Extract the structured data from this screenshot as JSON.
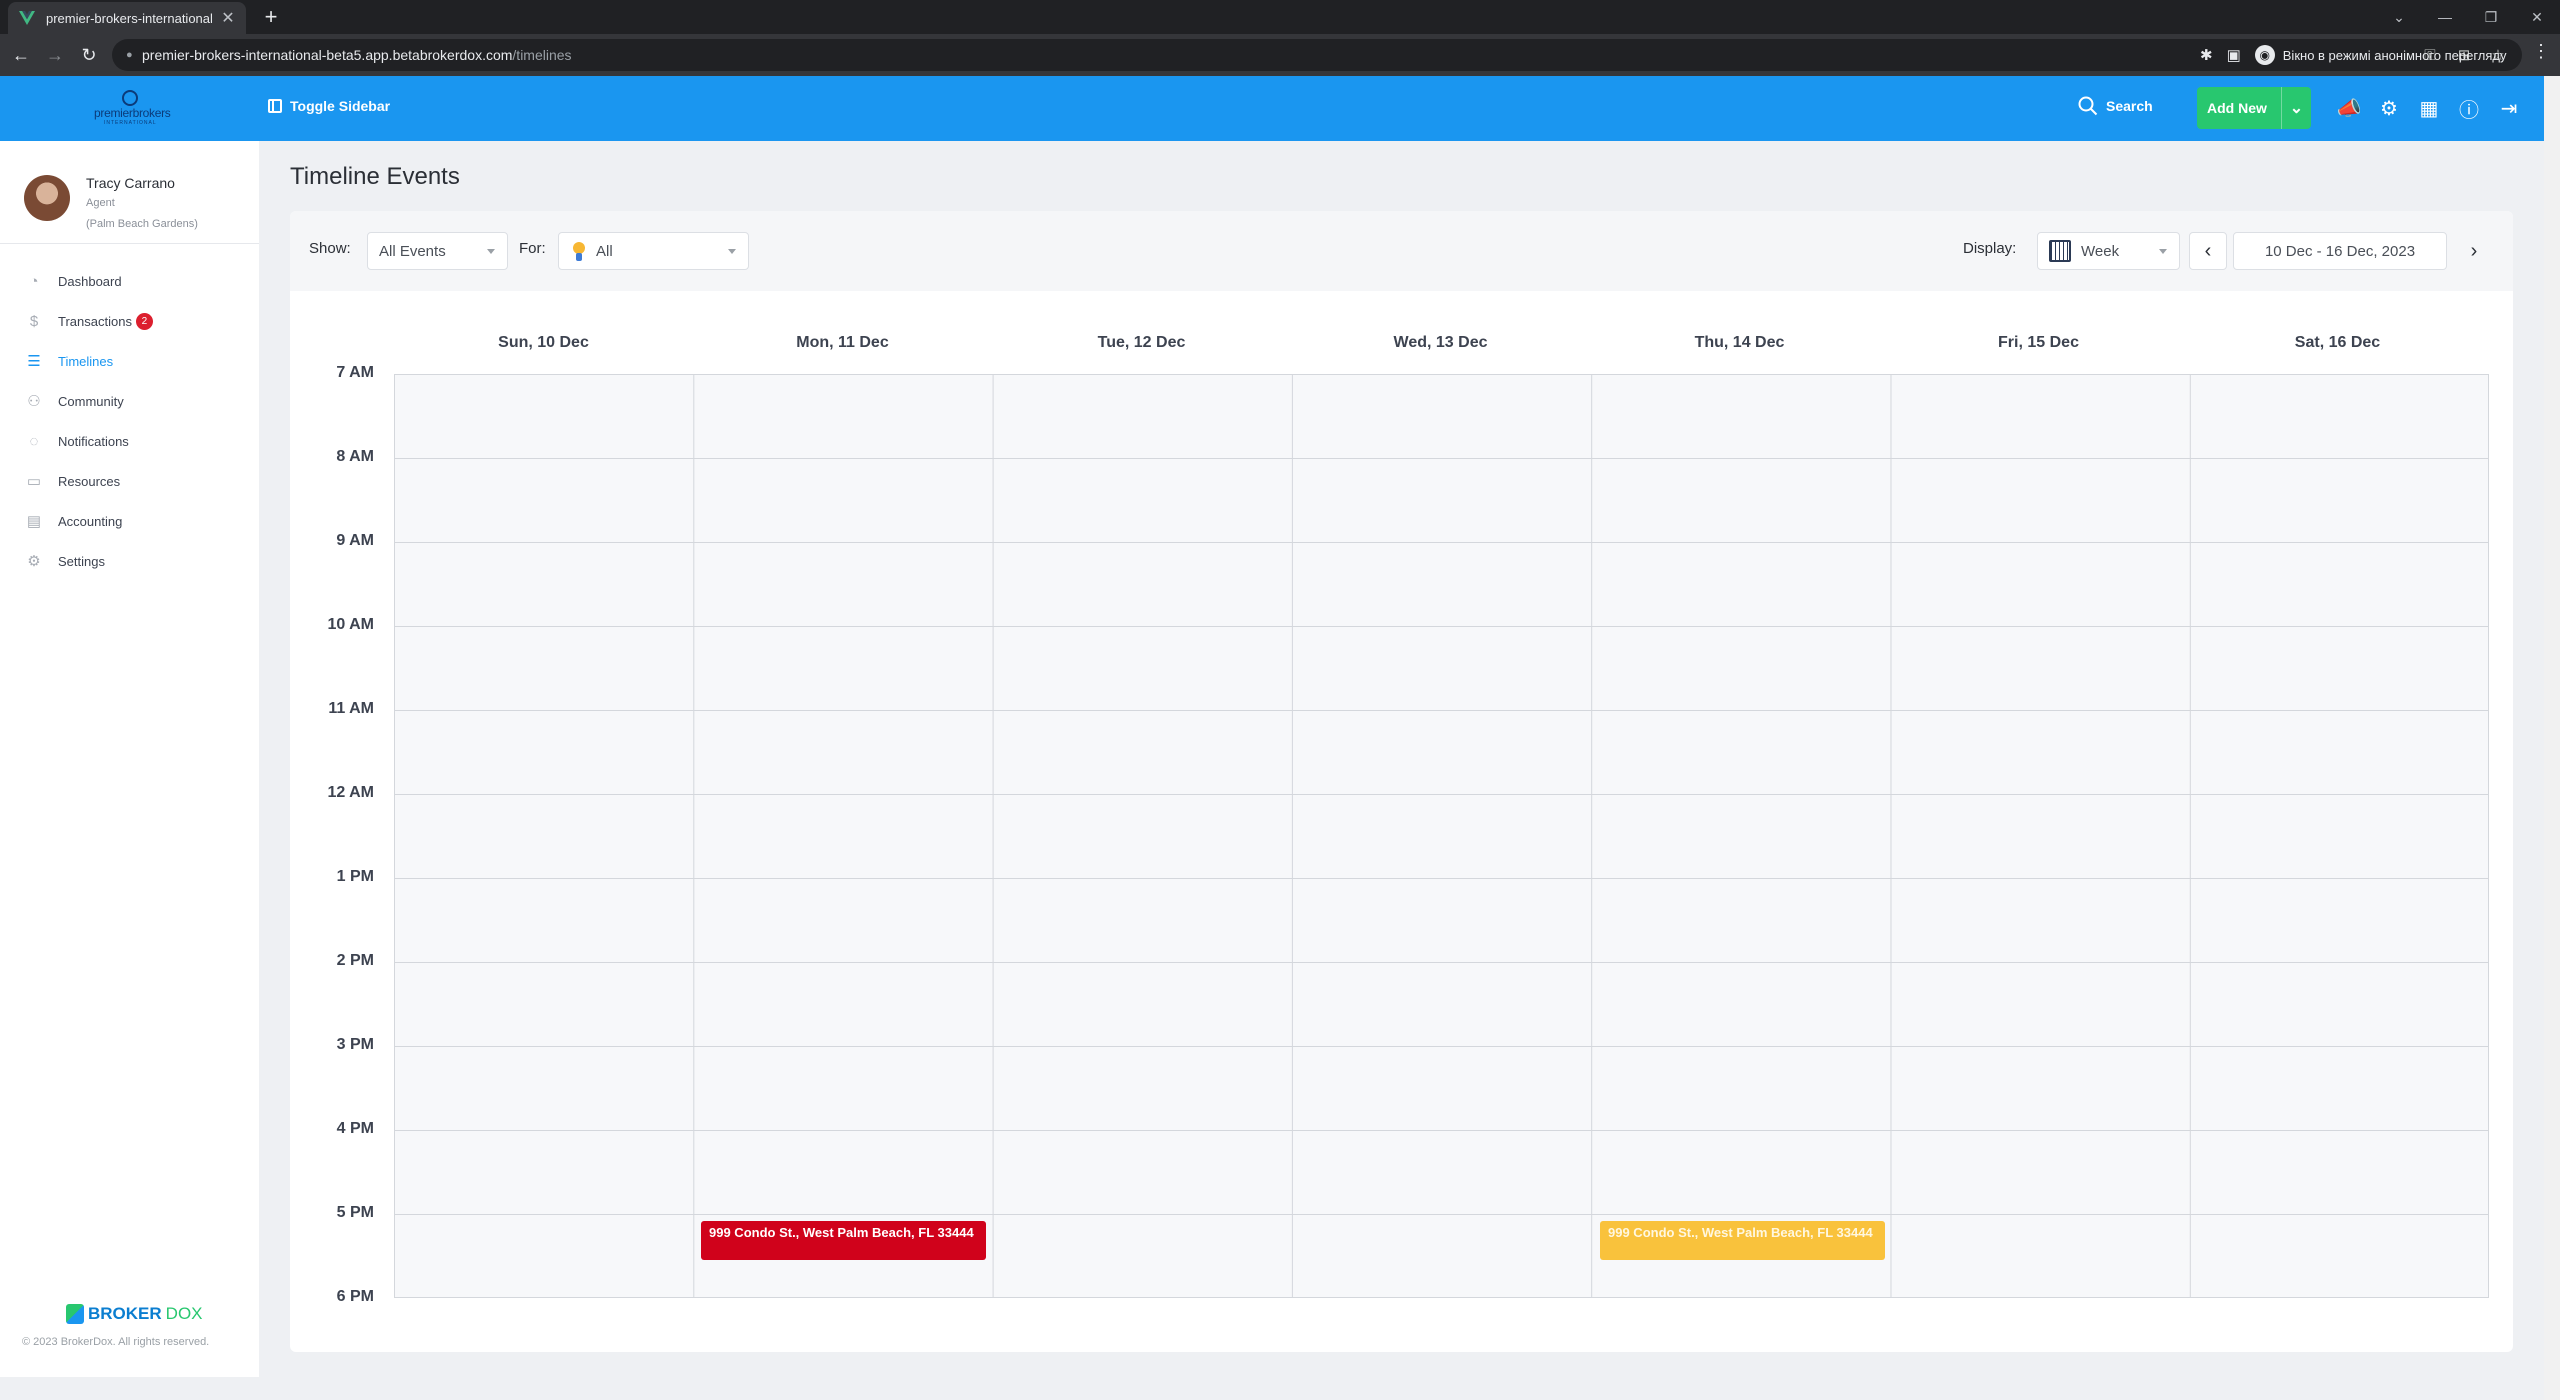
{
  "browser": {
    "tab_title": "premier-brokers-international",
    "tab_close": "✕",
    "new_tab": "+",
    "url_host": "premier-brokers-international-beta5.app.betabrokerdox.com",
    "url_path": "/timelines",
    "incognito_label": "Вікно в режимі анонімного перегляду",
    "window_controls": [
      "⌄",
      "—",
      "❐",
      "✕"
    ]
  },
  "header": {
    "logo_word": "premierbrokers",
    "logo_sub": "INTERNATIONAL",
    "toggle_label": "Toggle Sidebar",
    "search_label": "Search",
    "add_new_label": "Add New",
    "icons": [
      "megaphone-icon",
      "gear-icon",
      "calculator-icon",
      "help-icon",
      "logout-icon"
    ]
  },
  "profile": {
    "name": "Tracy Carrano",
    "role": "Agent",
    "office": "(Palm Beach Gardens)"
  },
  "sidebar": {
    "items": [
      {
        "label": "Dashboard",
        "icon": "dashboard-icon",
        "active": false
      },
      {
        "label": "Transactions",
        "icon": "dollar-icon",
        "active": false,
        "badge": "2"
      },
      {
        "label": "Timelines",
        "icon": "timeline-icon",
        "active": true
      },
      {
        "label": "Community",
        "icon": "community-icon",
        "active": false
      },
      {
        "label": "Notifications",
        "icon": "bell-icon",
        "active": false
      },
      {
        "label": "Resources",
        "icon": "folder-icon",
        "active": false
      },
      {
        "label": "Accounting",
        "icon": "accounting-icon",
        "active": false
      },
      {
        "label": "Settings",
        "icon": "gear-icon",
        "active": false
      }
    ],
    "brand_part1": "BROKER",
    "brand_part2": "DOX",
    "copyright": "© 2023 BrokerDox. All rights reserved."
  },
  "main": {
    "title": "Timeline Events",
    "show_label": "Show:",
    "show_value": "All Events",
    "for_label": "For:",
    "for_value": "All",
    "display_label": "Display:",
    "display_value": "Week",
    "date_range": "10 Dec - 16 Dec, 2023",
    "prev": "‹",
    "next": "›"
  },
  "calendar": {
    "days": [
      "Sun, 10 Dec",
      "Mon, 11 Dec",
      "Tue, 12 Dec",
      "Wed, 13 Dec",
      "Thu, 14 Dec",
      "Fri, 15 Dec",
      "Sat, 16 Dec"
    ],
    "times": [
      "7 AM",
      "8 AM",
      "9 AM",
      "10 AM",
      "11 AM",
      "12 AM",
      "1 PM",
      "2 PM",
      "3 PM",
      "4 PM",
      "5 PM",
      "6 PM"
    ],
    "events": [
      {
        "title": "999 Condo St., West Palm Beach, FL 33444",
        "day": "Mon, 11 Dec",
        "start": "5 PM",
        "color": "#d0021b"
      },
      {
        "title": "999 Condo St., West Palm Beach, FL 33444",
        "day": "Thu, 14 Dec",
        "start": "5 PM",
        "color": "#f9c23c"
      }
    ]
  },
  "colors": {
    "header_blue": "#1a96f0",
    "add_green": "#28c76f",
    "badge_red": "#dc1f2e"
  }
}
